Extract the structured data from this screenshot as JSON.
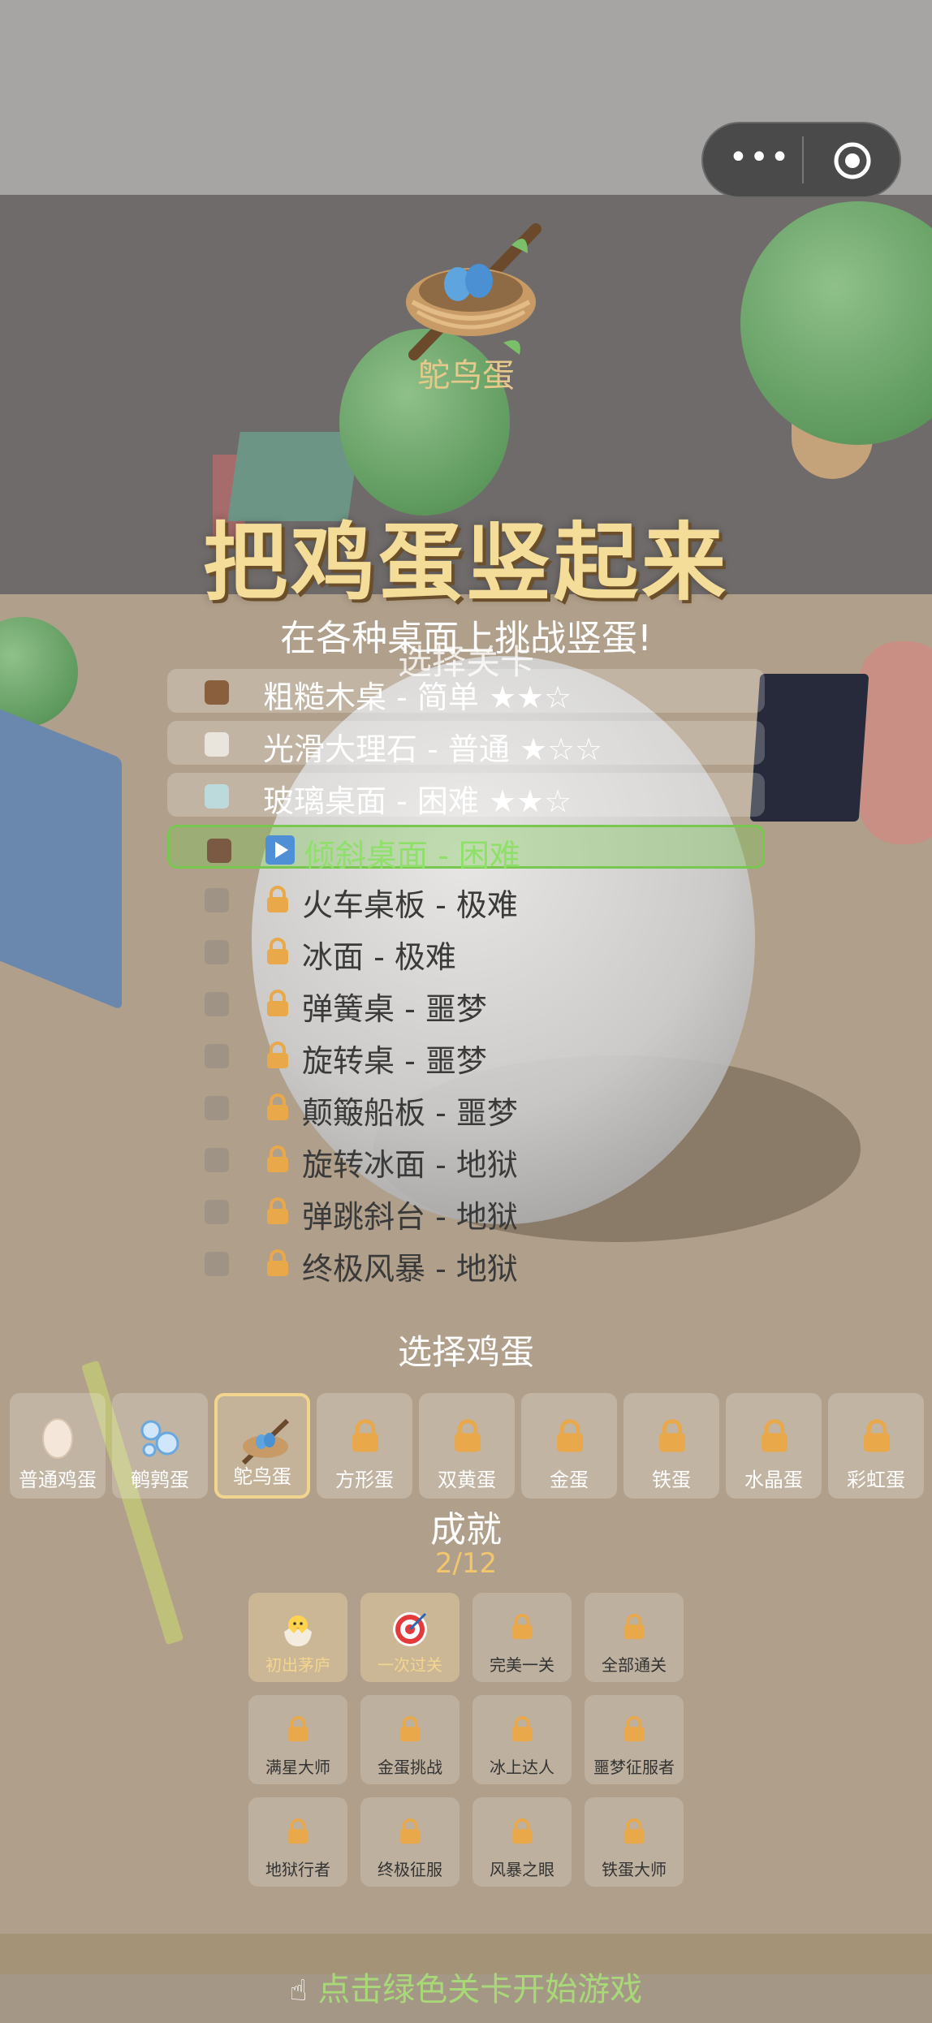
{
  "capsule": {
    "more_icon": "more-dots-icon",
    "close_icon": "target-circle-icon"
  },
  "header": {
    "selected_egg_name": "鸵鸟蛋",
    "title": "把鸡蛋竖起来",
    "subtitle": "在各种桌面上挑战竖蛋!",
    "level_section_title": "选择关卡"
  },
  "levels": [
    {
      "label": "粗糙木桌 - 简单 ★★☆",
      "state": "unlocked",
      "swatch": "#8a5f3e"
    },
    {
      "label": "光滑大理石 - 普通 ★☆☆",
      "state": "unlocked",
      "swatch": "#e9e4dc"
    },
    {
      "label": "玻璃桌面 - 困难 ★★☆",
      "state": "unlocked",
      "swatch": "#bcd9dc"
    },
    {
      "label": "倾斜桌面 - 困难",
      "state": "active",
      "swatch": "#7b5a43"
    },
    {
      "label": "火车桌板 - 极难",
      "state": "locked",
      "swatch": "#9f9385"
    },
    {
      "label": "冰面 - 极难",
      "state": "locked",
      "swatch": "#9f9385"
    },
    {
      "label": "弹簧桌 - 噩梦",
      "state": "locked",
      "swatch": "#9f9385"
    },
    {
      "label": "旋转桌 - 噩梦",
      "state": "locked",
      "swatch": "#9f9385"
    },
    {
      "label": "颠簸船板 - 噩梦",
      "state": "locked",
      "swatch": "#9f9385"
    },
    {
      "label": "旋转冰面 - 地狱",
      "state": "locked",
      "swatch": "#9f9385"
    },
    {
      "label": "弹跳斜台 - 地狱",
      "state": "locked",
      "swatch": "#9f9385"
    },
    {
      "label": "终极风暴 - 地狱",
      "state": "locked",
      "swatch": "#9f9385"
    }
  ],
  "egg_section_title": "选择鸡蛋",
  "eggs": [
    {
      "label": "普通鸡蛋",
      "icon": "egg-icon",
      "state": "unlocked"
    },
    {
      "label": "鹌鹑蛋",
      "icon": "bubbles-icon",
      "state": "unlocked"
    },
    {
      "label": "鸵鸟蛋",
      "icon": "nest-icon",
      "state": "selected"
    },
    {
      "label": "方形蛋",
      "icon": "lock-icon",
      "state": "locked"
    },
    {
      "label": "双黄蛋",
      "icon": "lock-icon",
      "state": "locked"
    },
    {
      "label": "金蛋",
      "icon": "lock-icon",
      "state": "locked"
    },
    {
      "label": "铁蛋",
      "icon": "lock-icon",
      "state": "locked"
    },
    {
      "label": "水晶蛋",
      "icon": "lock-icon",
      "state": "locked"
    },
    {
      "label": "彩虹蛋",
      "icon": "lock-icon",
      "state": "locked"
    }
  ],
  "achievements_title": "成就",
  "achievements_count": "2/12",
  "achievements": [
    {
      "label": "初出茅庐",
      "icon": "hatching-chick-icon",
      "state": "unlocked"
    },
    {
      "label": "一次过关",
      "icon": "bullseye-icon",
      "state": "unlocked"
    },
    {
      "label": "完美一关",
      "icon": "lock-icon",
      "state": "locked"
    },
    {
      "label": "全部通关",
      "icon": "lock-icon",
      "state": "locked"
    },
    {
      "label": "满星大师",
      "icon": "lock-icon",
      "state": "locked"
    },
    {
      "label": "金蛋挑战",
      "icon": "lock-icon",
      "state": "locked"
    },
    {
      "label": "冰上达人",
      "icon": "lock-icon",
      "state": "locked"
    },
    {
      "label": "噩梦征服者",
      "icon": "lock-icon",
      "state": "locked"
    },
    {
      "label": "地狱行者",
      "icon": "lock-icon",
      "state": "locked"
    },
    {
      "label": "终极征服",
      "icon": "lock-icon",
      "state": "locked"
    },
    {
      "label": "风暴之眼",
      "icon": "lock-icon",
      "state": "locked"
    },
    {
      "label": "铁蛋大师",
      "icon": "lock-icon",
      "state": "locked"
    }
  ],
  "hint": {
    "icon": "pointing-hand-icon",
    "text": "点击绿色关卡开始游戏"
  },
  "colors": {
    "accent_green": "#78c850",
    "gold": "#f1c66c",
    "title": "#f4dc99",
    "lock": "#e9a84a"
  }
}
